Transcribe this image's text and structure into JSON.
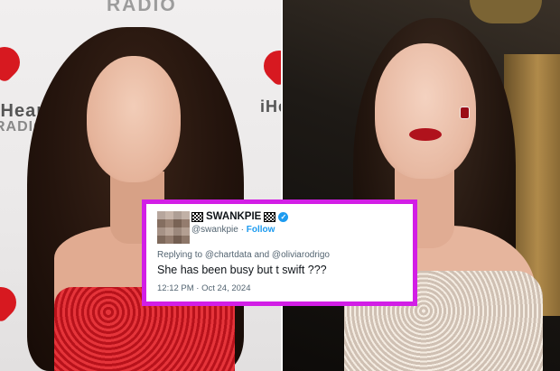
{
  "left_photo": {
    "backdrop_top_text": "RADIO",
    "backdrop_left_text": "iHeart",
    "backdrop_right_text": "iHeart",
    "backdrop_radio_text": "RADIO",
    "brand_color": "#d71920"
  },
  "tweet": {
    "display_name": "SWANKPIE",
    "handle": "@swankpie",
    "separator": "·",
    "follow_label": "Follow",
    "reply_prefix": "Replying to",
    "reply_mention_1": "@chartdata",
    "reply_and": "and",
    "reply_mention_2": "@oliviarodrigo",
    "text": "She has been busy but t swift ???",
    "timestamp": "12:12 PM · Oct 24, 2024",
    "verified_icon": "verified-badge-icon",
    "flag_icon": "checkered-flag-icon",
    "border_color": "#d21ee6",
    "link_color": "#1d9bf0"
  }
}
